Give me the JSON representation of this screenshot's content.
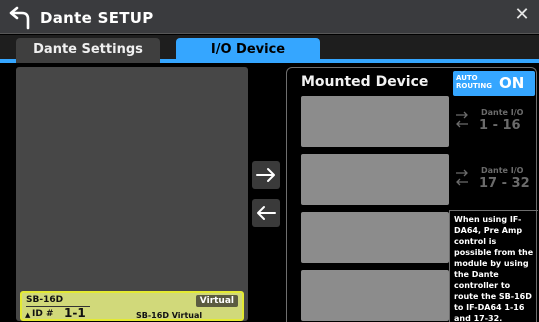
{
  "titlebar": {
    "title": "Dante SETUP",
    "back_icon": "back-arrow-icon",
    "close_glyph": "✕"
  },
  "tabs": [
    {
      "label": "Dante Settings",
      "active": false
    },
    {
      "label": "I/O Device",
      "active": true
    }
  ],
  "left_panel": {
    "device_card": {
      "name": "SB-16D",
      "badge": "Virtual",
      "id_label": "ID #",
      "id_value": "1-1",
      "model": "SB-16D Virtual",
      "arrow_glyph": "▲"
    }
  },
  "controls": {
    "assign_right_icon": "arrow-right-icon",
    "assign_left_icon": "arrow-left-icon"
  },
  "mounted_device": {
    "title": "Mounted Device",
    "auto_routing": {
      "label": "AUTO ROUTING",
      "state": "ON"
    },
    "io_groups": [
      {
        "label": "Dante I/O",
        "range": "1 - 16"
      },
      {
        "label": "Dante I/O",
        "range": "17 - 32"
      }
    ],
    "note": "When using IF-DA64, Pre Amp control is possible from the module by using the Dante controller to route the SB-16D to IF-DA64 1-16 and 17-32."
  },
  "colors": {
    "accent": "#35a6ff",
    "card_bg": "#d1d97a",
    "card_border": "#e4ea32",
    "slot": "#8c8c8c"
  }
}
